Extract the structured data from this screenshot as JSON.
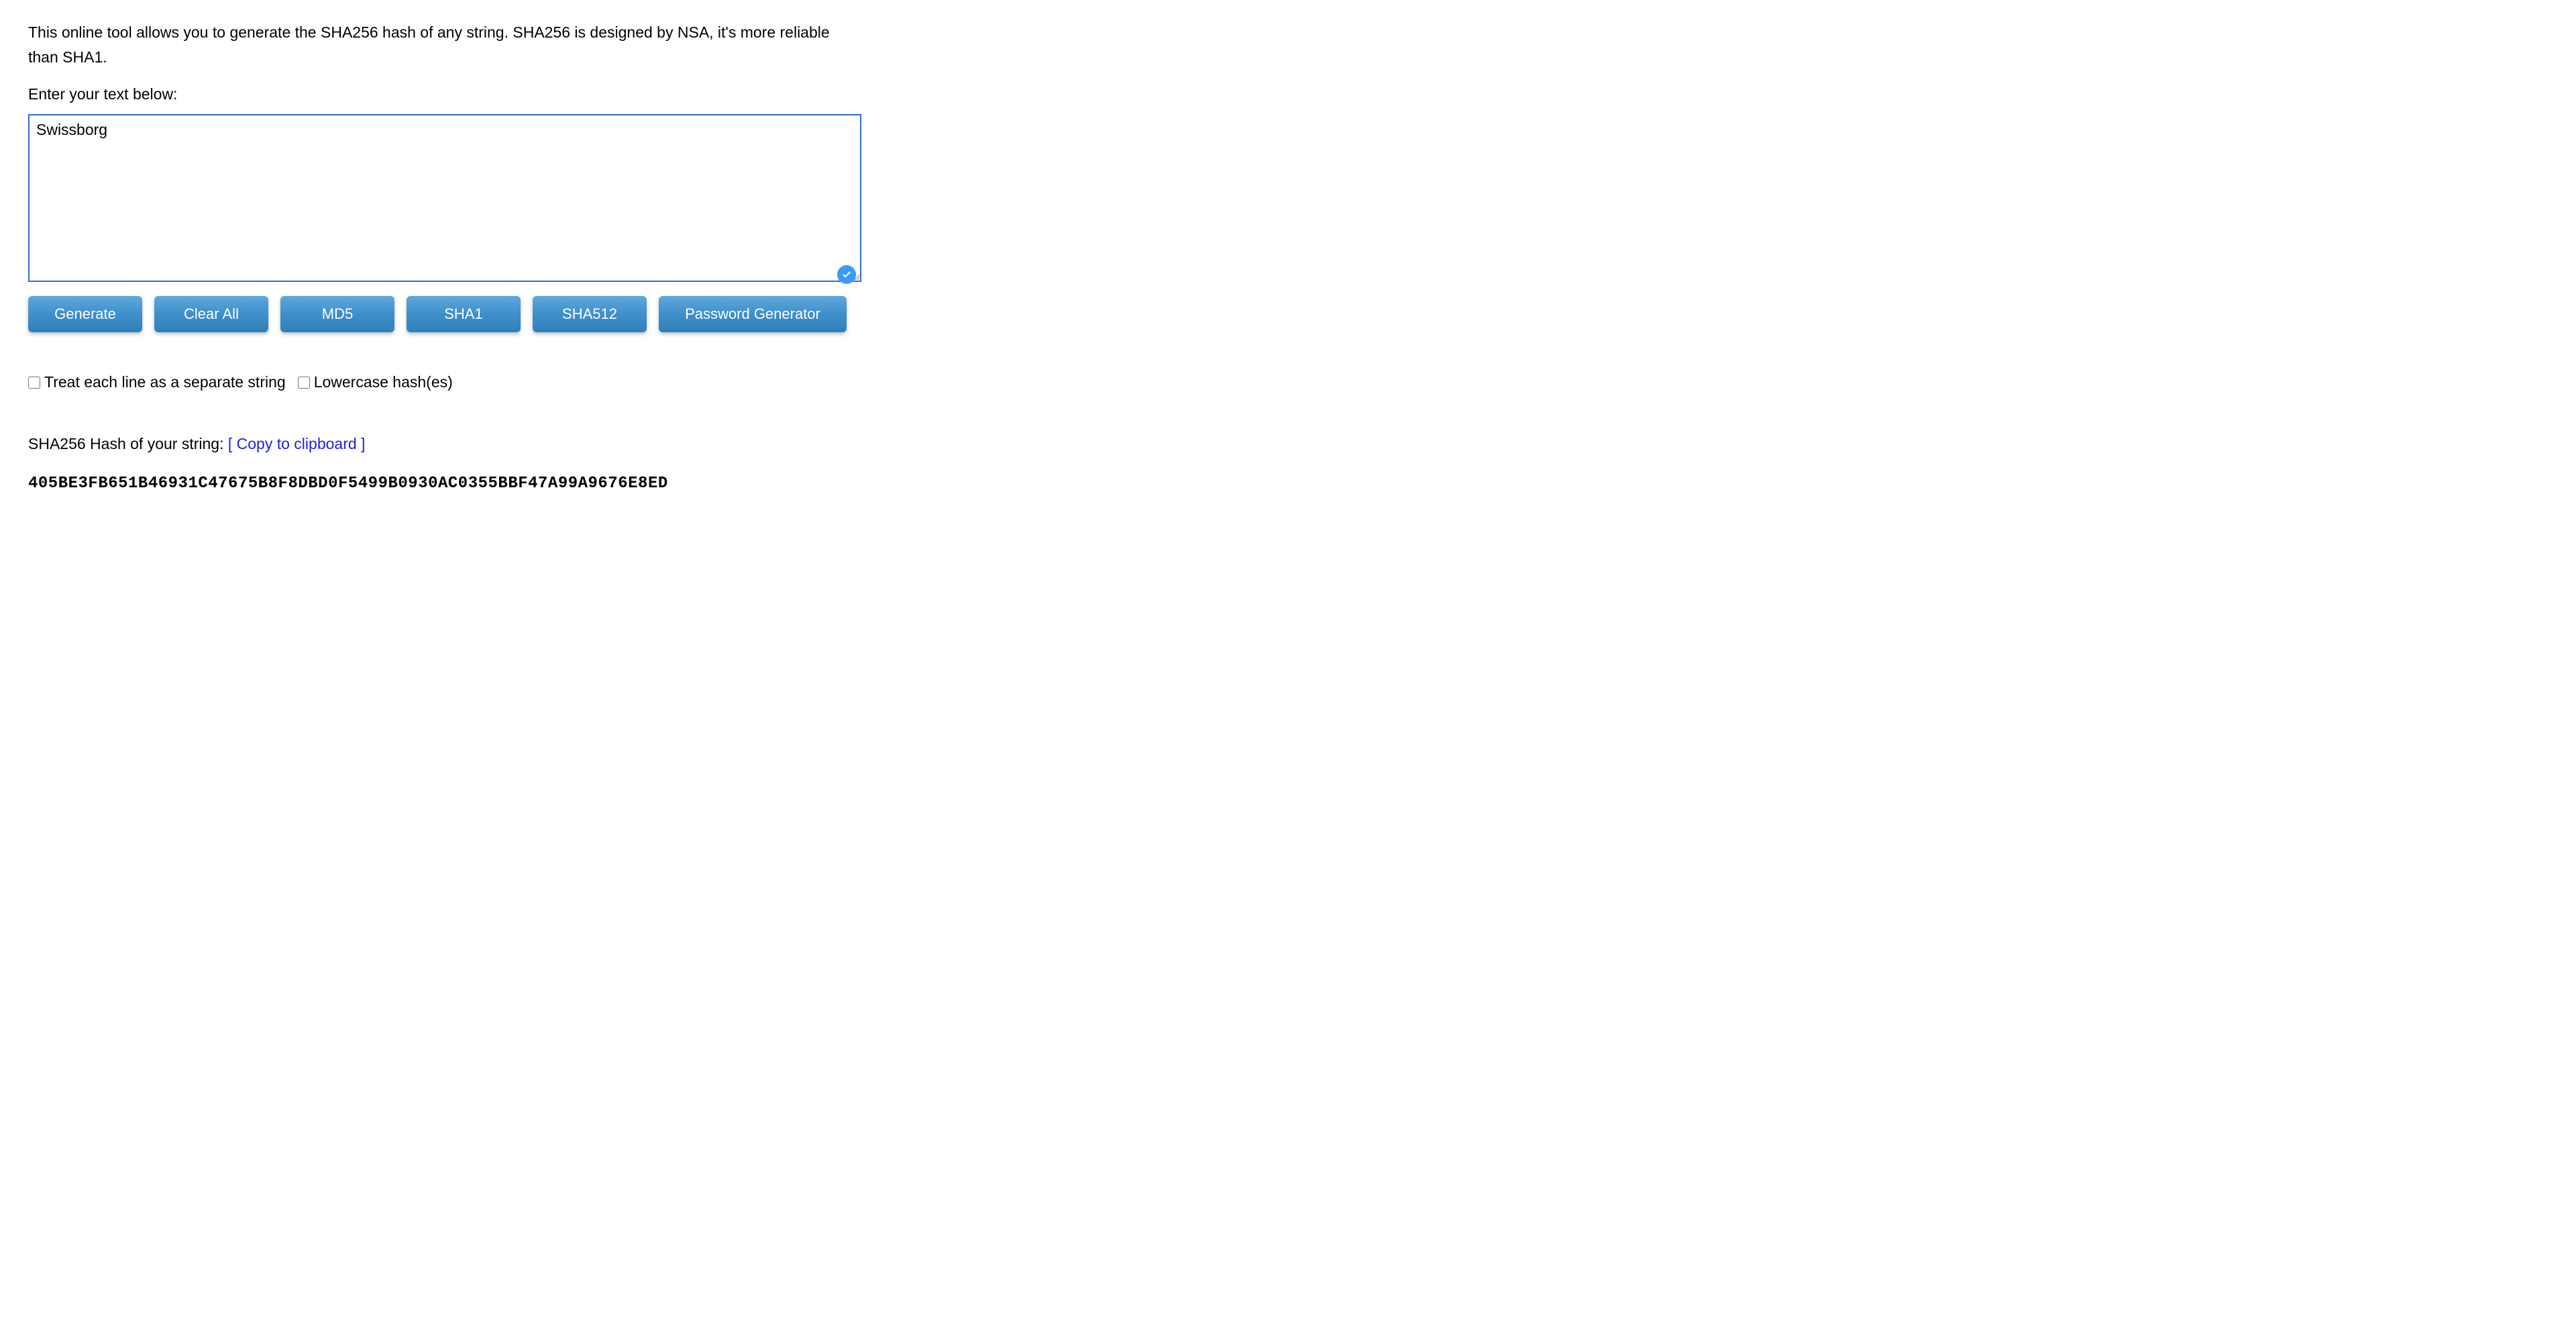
{
  "intro": "This online tool allows you to generate the SHA256 hash of any string. SHA256 is designed by NSA, it's more reliable than SHA1.",
  "prompt": "Enter your text below:",
  "input_value": "Swissborg",
  "buttons": {
    "generate": "Generate",
    "clear_all": "Clear All",
    "md5": "MD5",
    "sha1": "SHA1",
    "sha512": "SHA512",
    "password_generator": "Password Generator"
  },
  "checkboxes": {
    "treat_each_line": "Treat each line as a separate string",
    "lowercase": "Lowercase hash(es)"
  },
  "result": {
    "label_prefix": "SHA256 Hash of your string: ",
    "copy_open": "[ ",
    "copy_text": "Copy to clipboard",
    "copy_close": " ]",
    "hash": "405BE3FB651B46931C47675B8F8DBD0F5499B0930AC0355BBF47A99A9676E8ED"
  },
  "colors": {
    "button_bg_top": "#5fa9dc",
    "button_bg_bottom": "#2f7fb9",
    "focus_border": "#2a6fdc",
    "link": "#2020dd",
    "badge": "#3b99fc"
  }
}
